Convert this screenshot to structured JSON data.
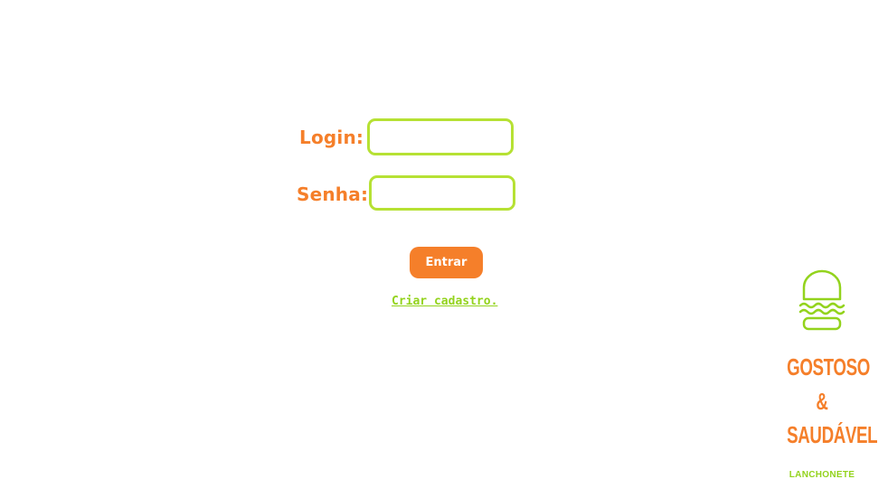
{
  "login_form": {
    "login_label": "Login:",
    "login_value": "",
    "password_label": "Senha:",
    "password_value": "",
    "submit_label": "Entrar",
    "register_link": "Criar cadastro."
  },
  "brand": {
    "logo_icon": "burger-icon",
    "name_line1": "GOSTOSO",
    "name_line2": "&",
    "name_line3": "SAUDÁVEL",
    "tagline": "LANCHONETE"
  },
  "colors": {
    "accent_orange": "#f57f2a",
    "accent_green": "#b6e134",
    "link_green": "#93d31d",
    "background": "#ffffff"
  }
}
